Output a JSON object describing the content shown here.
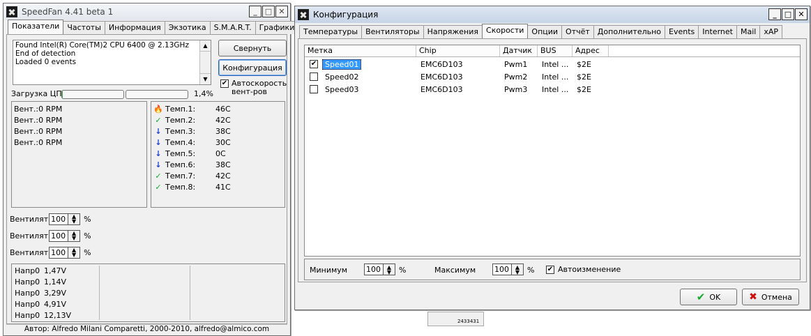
{
  "speedfan": {
    "title": "SpeedFan 4.41 beta 1",
    "tabs": [
      "Показатели",
      "Частоты",
      "Информация",
      "Экзотика",
      "S.M.A.R.T.",
      "Графики"
    ],
    "log": [
      "Found Intel(R) Core(TM)2 CPU 6400 @ 2.13GHz",
      "End of detection",
      "Loaded 0 events"
    ],
    "minimize_button": "Свернуть",
    "configure_button": "Конфигурация",
    "auto_speed_label": "Автоскорость вент-ров",
    "auto_speed_checked": true,
    "cpu_load_label": "Загрузка ЦП",
    "cpu_load_value": "1,4%",
    "cpu_load_fraction": 0.014,
    "fans": [
      "Вент.:0 RPM",
      "Вент.:0 RPM",
      "Вент.:0 RPM",
      "Вент.:0 RPM"
    ],
    "temps": [
      {
        "label": "Темп.1:",
        "value": "46C",
        "icon": "fire-icon"
      },
      {
        "label": "Темп.2:",
        "value": "42C",
        "icon": "checkmark-icon"
      },
      {
        "label": "Темп.3:",
        "value": "38C",
        "icon": "arrow-down-icon"
      },
      {
        "label": "Темп.4:",
        "value": "30C",
        "icon": "arrow-down-icon"
      },
      {
        "label": "Темп.5:",
        "value": "0C",
        "icon": "arrow-down-icon"
      },
      {
        "label": "Темп.6:",
        "value": "38C",
        "icon": "arrow-down-icon"
      },
      {
        "label": "Темп.7:",
        "value": "42C",
        "icon": "checkmark-icon"
      },
      {
        "label": "Темп.8:",
        "value": "41C",
        "icon": "checkmark-icon"
      }
    ],
    "fan_controls": [
      {
        "label": "Вентилят",
        "value": "100",
        "unit": "%"
      },
      {
        "label": "Вентилят",
        "value": "100",
        "unit": "%"
      },
      {
        "label": "Вентилят",
        "value": "100",
        "unit": "%"
      }
    ],
    "voltages": [
      {
        "label": "Напр0",
        "value": "1,47V"
      },
      {
        "label": "Напр0",
        "value": "1,14V"
      },
      {
        "label": "Напр0",
        "value": "3,29V"
      },
      {
        "label": "Напр0",
        "value": "4,91V"
      },
      {
        "label": "Напр0",
        "value": "12,13V"
      }
    ],
    "status": "Автор: Alfredo Milani Comparetti, 2000-2010, alfredo@almico.com"
  },
  "config": {
    "title": "Конфигурация",
    "tabs": [
      "Температуры",
      "Вентиляторы",
      "Напряжения",
      "Скорости",
      "Опции",
      "Отчёт",
      "Дополнительно",
      "Events",
      "Internet",
      "Mail",
      "xAP"
    ],
    "active_tab": 3,
    "columns": [
      "Метка",
      "Chip",
      "Датчик",
      "BUS",
      "Адрес"
    ],
    "rows": [
      {
        "checked": true,
        "label": "Speed01",
        "chip": "EMC6D103",
        "sensor": "Pwm1",
        "bus": "Intel ...",
        "address": "$2E"
      },
      {
        "checked": false,
        "label": "Speed02",
        "chip": "EMC6D103",
        "sensor": "Pwm2",
        "bus": "Intel ...",
        "address": "$2E"
      },
      {
        "checked": false,
        "label": "Speed03",
        "chip": "EMC6D103",
        "sensor": "Pwm3",
        "bus": "Intel ...",
        "address": "$2E"
      }
    ],
    "min_label": "Минимум",
    "min_value": "100",
    "max_label": "Максимум",
    "max_value": "100",
    "percent": "%",
    "auto_change_label": "Автоизменение",
    "auto_change_checked": true,
    "ok_button": "OK",
    "cancel_button": "Отмена"
  },
  "fragment": {
    "text": "2433431"
  }
}
